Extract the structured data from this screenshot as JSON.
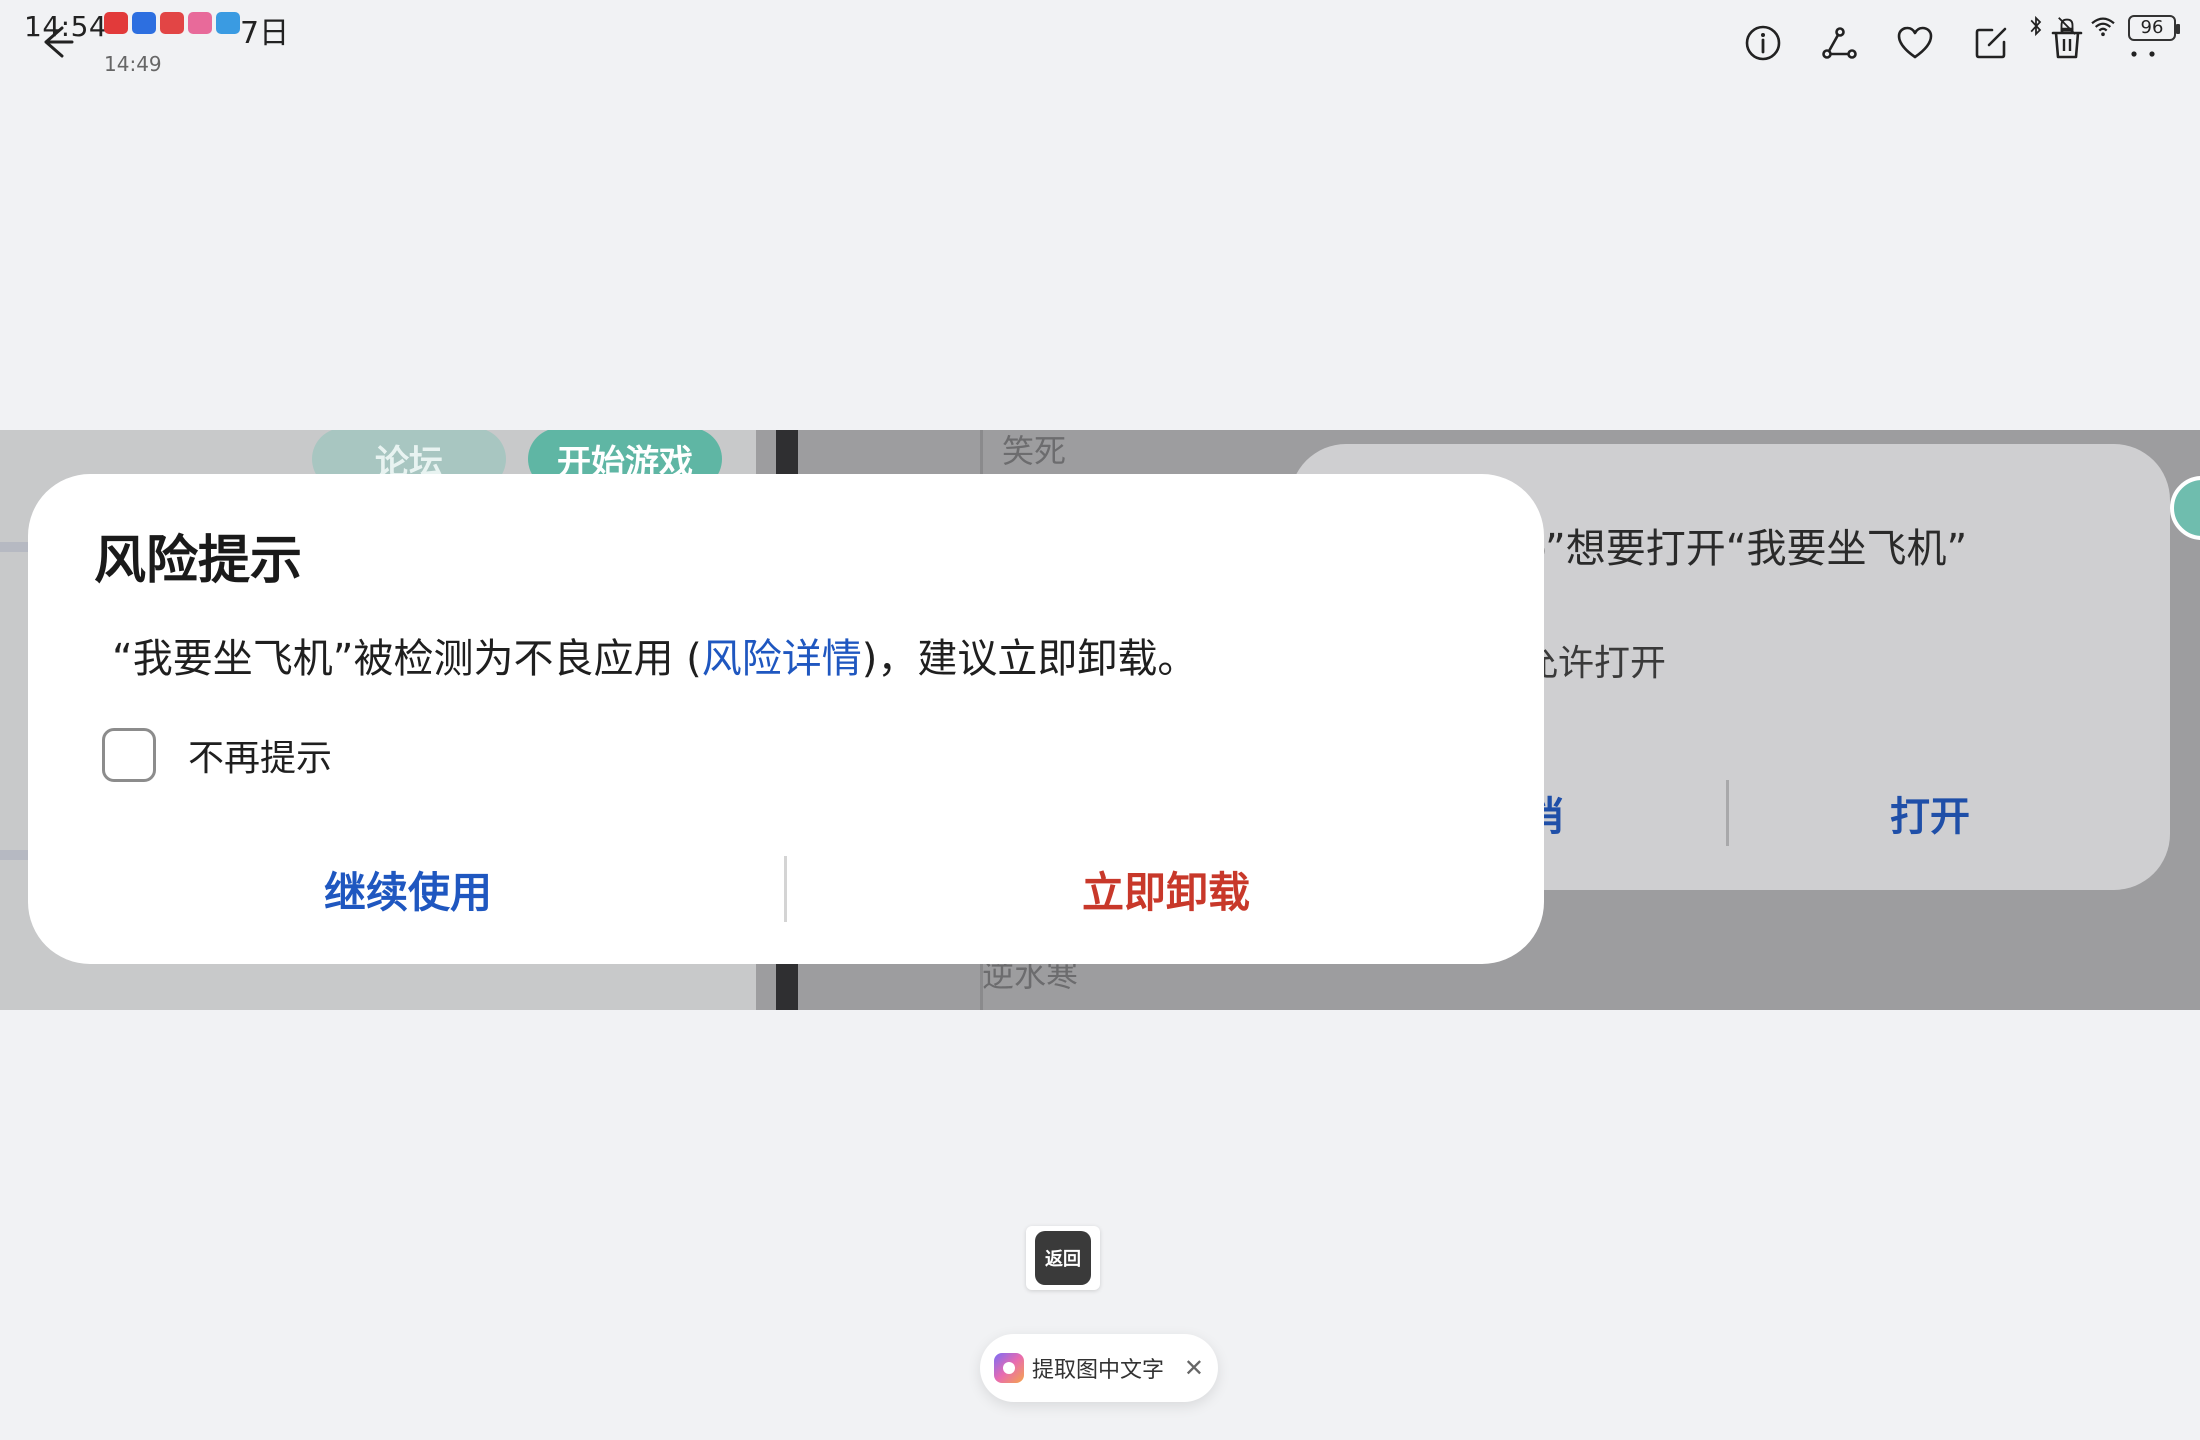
{
  "status_bar": {
    "time": "14:54",
    "date": "7日",
    "notification_colors": [
      "#e23a3a",
      "#2d6fe0",
      "#e24545",
      "#e86a9a",
      "#3a9be2"
    ],
    "battery": "96"
  },
  "viewer": {
    "photo_time": "14:49",
    "toolbar_icons": [
      "info-icon",
      "share-icon",
      "heart-icon",
      "edit-icon",
      "trash-icon",
      "more-icon"
    ]
  },
  "screenshot": {
    "forum_tab": "论坛",
    "start_game_button": "开始游戏",
    "bg_text_top": "笑死",
    "bg_text_bottom": "逆水寒",
    "open_prompt": {
      "title": "o”想要打开“我要坐飞机”",
      "subtitle": "允许打开",
      "cancel": "消",
      "open": "打开"
    }
  },
  "risk_dialog": {
    "title": "风险提示",
    "message_before": "“我要坐飞机”被检测为不良应用 (",
    "message_link": "风险详情",
    "message_after": ")，建议立即卸载。",
    "checkbox_label": "不再提示",
    "continue_button": "继续使用",
    "uninstall_button": "立即卸载",
    "colors": {
      "accent": "#1f57c0",
      "danger": "#c8382a"
    }
  },
  "bottom": {
    "thumbnail_label": "返回",
    "ocr_label": "提取图中文字",
    "ocr_close": "✕"
  }
}
